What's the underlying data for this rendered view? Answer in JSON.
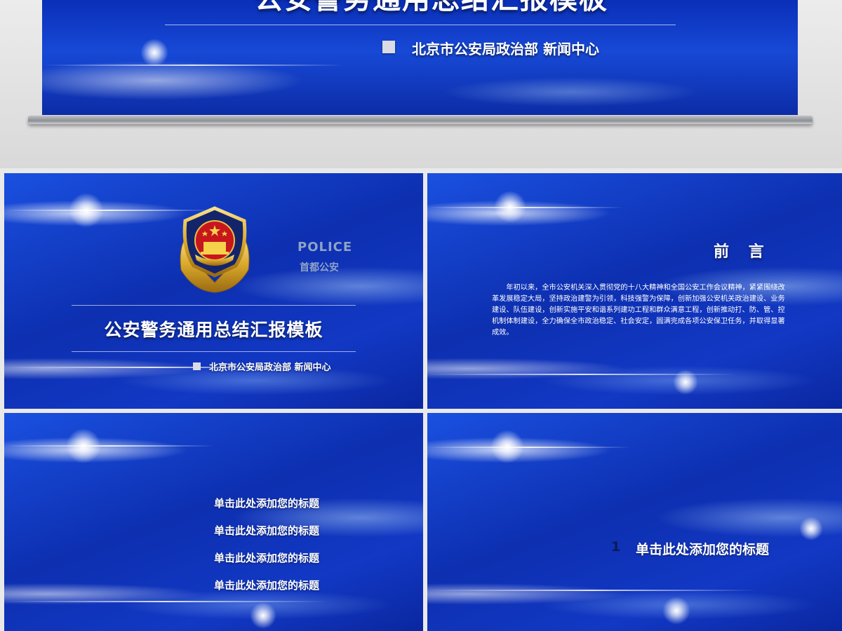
{
  "hero": {
    "title": "公安警务通用总结汇报模板",
    "subtitle": "北京市公安局政治部  新闻中心"
  },
  "slides": {
    "cover": {
      "badge_icon": "police-emblem-icon",
      "police_en": "POLICE",
      "police_cn": "首都公安",
      "title": "公安警务通用总结汇报模板",
      "subtitle": "北京市公安局政治部  新闻中心"
    },
    "preface": {
      "title": "前 言",
      "body": "年初以来，全市公安机关深入贯彻党的十八大精神和全国公安工作会议精神，紧紧围绕改革发展稳定大局，坚持政治建警为引领，科技强警为保障，创新加强公安机关政治建设、业务建设、队伍建设，创新实施平安和谐系列建功工程和群众满意工程，创新推动打、防、管、控机制体制建设，全力确保全市政治稳定、社会安定，圆满完成各项公安保卫任务，并取得显著成效。"
    },
    "contents": {
      "items": [
        "单击此处添加您的标题",
        "单击此处添加您的标题",
        "单击此处添加您的标题",
        "单击此处添加您的标题"
      ]
    },
    "section": {
      "number": "1",
      "title": "单击此处添加您的标题"
    }
  },
  "colors": {
    "slide_blue": "#0d2fb0",
    "emblem_gold": "#d9a92b",
    "emblem_red": "#c8161d",
    "emblem_navy": "#14246b"
  }
}
